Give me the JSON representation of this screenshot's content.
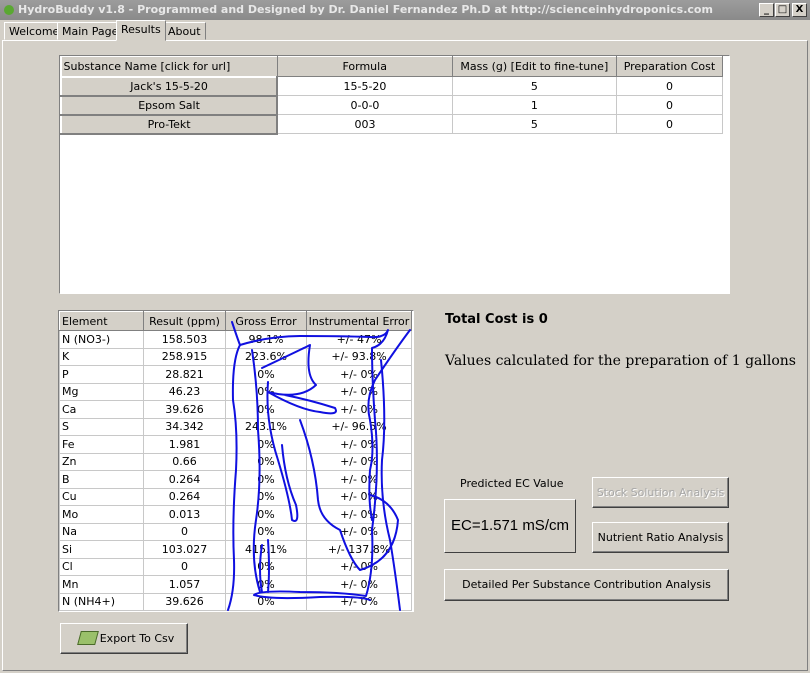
{
  "window": {
    "title": "HydroBuddy v1.8 - Programmed and Designed by Dr. Daniel Fernandez Ph.D at http://scienceinhydroponics.com",
    "minimize": "_",
    "maximize": "□",
    "close": "X"
  },
  "tabs": [
    {
      "label": "Welcome"
    },
    {
      "label": "Main Page"
    },
    {
      "label": "Results",
      "active": true
    },
    {
      "label": "About"
    }
  ],
  "substances": {
    "headers": [
      "Substance Name [click for url]",
      "Formula",
      "Mass (g) [Edit to fine-tune]",
      "Preparation Cost"
    ],
    "rows": [
      {
        "name": "Jack's 15-5-20",
        "formula": "15-5-20",
        "mass": "5",
        "cost": "0"
      },
      {
        "name": "Epsom Salt",
        "formula": "0-0-0",
        "mass": "1",
        "cost": "0"
      },
      {
        "name": "Pro-Tekt",
        "formula": "003",
        "mass": "5",
        "cost": "0"
      }
    ]
  },
  "results": {
    "headers": [
      "Element",
      "Result (ppm)",
      "Gross Error",
      "Instrumental Error"
    ],
    "rows": [
      {
        "element": "N (NO3-)",
        "ppm": "158.503",
        "gross": "98.1%",
        "instr": "+/- 47%"
      },
      {
        "element": "K",
        "ppm": "258.915",
        "gross": "223.6%",
        "instr": "+/- 93.8%"
      },
      {
        "element": "P",
        "ppm": "28.821",
        "gross": "0%",
        "instr": "+/- 0%"
      },
      {
        "element": "Mg",
        "ppm": "46.23",
        "gross": "0%",
        "instr": "+/- 0%"
      },
      {
        "element": "Ca",
        "ppm": "39.626",
        "gross": "0%",
        "instr": "+/- 0%"
      },
      {
        "element": "S",
        "ppm": "34.342",
        "gross": "243.1%",
        "instr": "+/- 96.5%"
      },
      {
        "element": "Fe",
        "ppm": "1.981",
        "gross": "0%",
        "instr": "+/- 0%"
      },
      {
        "element": "Zn",
        "ppm": "0.66",
        "gross": "0%",
        "instr": "+/- 0%"
      },
      {
        "element": "B",
        "ppm": "0.264",
        "gross": "0%",
        "instr": "+/- 0%"
      },
      {
        "element": "Cu",
        "ppm": "0.264",
        "gross": "0%",
        "instr": "+/- 0%"
      },
      {
        "element": "Mo",
        "ppm": "0.013",
        "gross": "0%",
        "instr": "+/- 0%"
      },
      {
        "element": "Na",
        "ppm": "0",
        "gross": "0%",
        "instr": "+/- 0%"
      },
      {
        "element": "Si",
        "ppm": "103.027",
        "gross": "415.1%",
        "instr": "+/- 137.8%"
      },
      {
        "element": "Cl",
        "ppm": "0",
        "gross": "0%",
        "instr": "+/- 0%"
      },
      {
        "element": "Mn",
        "ppm": "1.057",
        "gross": "0%",
        "instr": "+/- 0%"
      },
      {
        "element": "N (NH4+)",
        "ppm": "39.626",
        "gross": "0%",
        "instr": "+/- 0%"
      }
    ]
  },
  "summary": {
    "total_cost": "Total Cost is 0",
    "values_note": "Values calculated for the preparation of 1 gallons"
  },
  "ec": {
    "label": "Predicted EC Value",
    "value": "EC=1.571 mS/cm"
  },
  "buttons": {
    "stock": "Stock Solution Analysis",
    "ratio": "Nutrient Ratio Analysis",
    "detailed": "Detailed Per Substance Contribution Analysis",
    "export": "Export To Csv"
  },
  "annotation_color": "#1010e0"
}
